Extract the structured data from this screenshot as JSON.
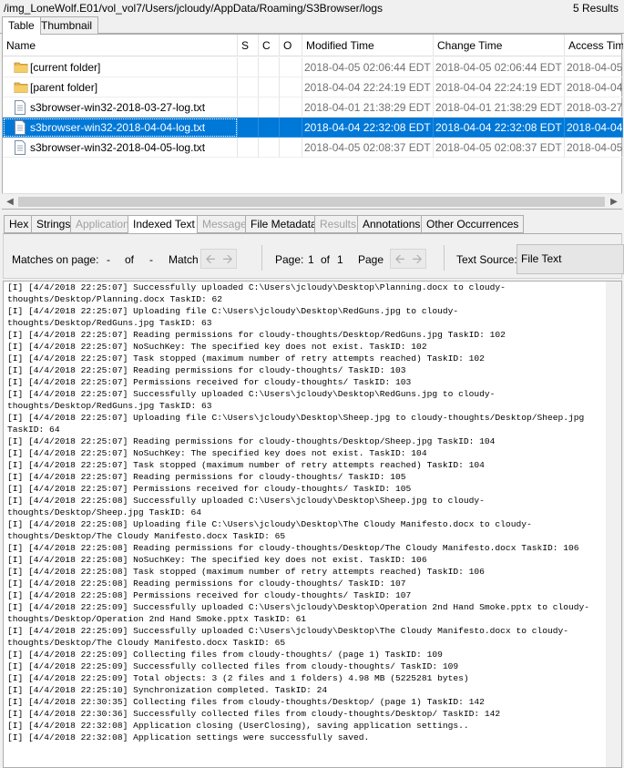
{
  "path_bar": {
    "path": "/img_LoneWolf.E01/vol_vol7/Users/jcloudy/AppData/Roaming/S3Browser/logs",
    "results": "5  Results"
  },
  "view_tabs": [
    "Table",
    "Thumbnail"
  ],
  "table": {
    "columns": [
      "Name",
      "S",
      "C",
      "O",
      "Modified Time",
      "Change Time",
      "Access Time"
    ],
    "rows": [
      {
        "name": "[current folder]",
        "type": "folder",
        "modified": "2018-04-05 02:06:44 EDT",
        "change": "2018-04-05 02:06:44 EDT",
        "access": "2018-04-05"
      },
      {
        "name": "[parent folder]",
        "type": "folder",
        "modified": "2018-04-04 22:24:19 EDT",
        "change": "2018-04-04 22:24:19 EDT",
        "access": "2018-04-04"
      },
      {
        "name": "s3browser-win32-2018-03-27-log.txt",
        "type": "file",
        "modified": "2018-04-01 21:38:29 EDT",
        "change": "2018-04-01 21:38:29 EDT",
        "access": "2018-03-27"
      },
      {
        "name": "s3browser-win32-2018-04-04-log.txt",
        "type": "file",
        "modified": "2018-04-04 22:32:08 EDT",
        "change": "2018-04-04 22:32:08 EDT",
        "access": "2018-04-04",
        "selected": true
      },
      {
        "name": "s3browser-win32-2018-04-05-log.txt",
        "type": "file",
        "modified": "2018-04-05 02:08:37 EDT",
        "change": "2018-04-05 02:08:37 EDT",
        "access": "2018-04-05"
      }
    ]
  },
  "content_tabs": [
    {
      "label": "Hex",
      "state": "normal"
    },
    {
      "label": "Strings",
      "state": "normal"
    },
    {
      "label": "Application",
      "state": "disabled"
    },
    {
      "label": "Indexed Text",
      "state": "active"
    },
    {
      "label": "Message",
      "state": "disabled"
    },
    {
      "label": "File Metadata",
      "state": "normal"
    },
    {
      "label": "Results",
      "state": "disabled"
    },
    {
      "label": "Annotations",
      "state": "normal"
    },
    {
      "label": "Other Occurrences",
      "state": "normal"
    }
  ],
  "toolbar": {
    "matches_label": "Matches on page:",
    "matches_value": "-",
    "of_label": "of",
    "matches_total": "-",
    "match_label": "Match",
    "page_label": "Page:",
    "page_value": "1",
    "page_of": "of",
    "page_total": "1",
    "page_nav_label": "Page",
    "text_source_label": "Text Source:",
    "text_source_value": "File Text"
  },
  "log_lines": [
    "[I] [4/4/2018 22:25:07] Successfully uploaded C:\\Users\\jcloudy\\Desktop\\Planning.docx to cloudy-thoughts/Desktop/Planning.docx TaskID: 62",
    "[I] [4/4/2018 22:25:07] Uploading file C:\\Users\\jcloudy\\Desktop\\RedGuns.jpg to cloudy-thoughts/Desktop/RedGuns.jpg TaskID: 63",
    "[I] [4/4/2018 22:25:07] Reading permissions for cloudy-thoughts/Desktop/RedGuns.jpg TaskID: 102",
    "[I] [4/4/2018 22:25:07] NoSuchKey: The specified key does not exist. TaskID: 102",
    "[I] [4/4/2018 22:25:07] Task stopped (maximum number of retry attempts reached) TaskID: 102",
    "[I] [4/4/2018 22:25:07] Reading permissions for cloudy-thoughts/ TaskID: 103",
    "[I] [4/4/2018 22:25:07] Permissions received for cloudy-thoughts/ TaskID: 103",
    "[I] [4/4/2018 22:25:07] Successfully uploaded C:\\Users\\jcloudy\\Desktop\\RedGuns.jpg to cloudy-thoughts/Desktop/RedGuns.jpg TaskID: 63",
    "[I] [4/4/2018 22:25:07] Uploading file C:\\Users\\jcloudy\\Desktop\\Sheep.jpg to cloudy-thoughts/Desktop/Sheep.jpg TaskID: 64",
    "[I] [4/4/2018 22:25:07] Reading permissions for cloudy-thoughts/Desktop/Sheep.jpg TaskID: 104",
    "[I] [4/4/2018 22:25:07] NoSuchKey: The specified key does not exist. TaskID: 104",
    "[I] [4/4/2018 22:25:07] Task stopped (maximum number of retry attempts reached) TaskID: 104",
    "[I] [4/4/2018 22:25:07] Reading permissions for cloudy-thoughts/ TaskID: 105",
    "[I] [4/4/2018 22:25:07] Permissions received for cloudy-thoughts/ TaskID: 105",
    "[I] [4/4/2018 22:25:08] Successfully uploaded C:\\Users\\jcloudy\\Desktop\\Sheep.jpg to cloudy-thoughts/Desktop/Sheep.jpg TaskID: 64",
    "[I] [4/4/2018 22:25:08] Uploading file C:\\Users\\jcloudy\\Desktop\\The Cloudy Manifesto.docx to cloudy-thoughts/Desktop/The Cloudy Manifesto.docx TaskID: 65",
    "[I] [4/4/2018 22:25:08] Reading permissions for cloudy-thoughts/Desktop/The Cloudy Manifesto.docx TaskID: 106",
    "[I] [4/4/2018 22:25:08] NoSuchKey: The specified key does not exist. TaskID: 106",
    "[I] [4/4/2018 22:25:08] Task stopped (maximum number of retry attempts reached) TaskID: 106",
    "[I] [4/4/2018 22:25:08] Reading permissions for cloudy-thoughts/ TaskID: 107",
    "[I] [4/4/2018 22:25:08] Permissions received for cloudy-thoughts/ TaskID: 107",
    "[I] [4/4/2018 22:25:09] Successfully uploaded C:\\Users\\jcloudy\\Desktop\\Operation 2nd Hand Smoke.pptx to cloudy-thoughts/Desktop/Operation 2nd Hand Smoke.pptx TaskID: 61",
    "[I] [4/4/2018 22:25:09] Successfully uploaded C:\\Users\\jcloudy\\Desktop\\The Cloudy Manifesto.docx to cloudy-thoughts/Desktop/The Cloudy Manifesto.docx TaskID: 65",
    "[I] [4/4/2018 22:25:09] Collecting files from cloudy-thoughts/ (page 1) TaskID: 109",
    "[I] [4/4/2018 22:25:09] Successfully collected files from cloudy-thoughts/ TaskID: 109",
    "[I] [4/4/2018 22:25:09] Total objects: 3 (2 files and 1 folders) 4.98 MB (5225281 bytes)",
    "[I] [4/4/2018 22:25:10] Synchronization completed. TaskID: 24",
    "[I] [4/4/2018 22:30:35] Collecting files from cloudy-thoughts/Desktop/ (page 1) TaskID: 142",
    "[I] [4/4/2018 22:30:36] Successfully collected files from cloudy-thoughts/Desktop/ TaskID: 142",
    "[I] [4/4/2018 22:32:08] Application closing (UserClosing), saving application settings..",
    "[I] [4/4/2018 22:32:08] Application settings were successfully saved."
  ]
}
